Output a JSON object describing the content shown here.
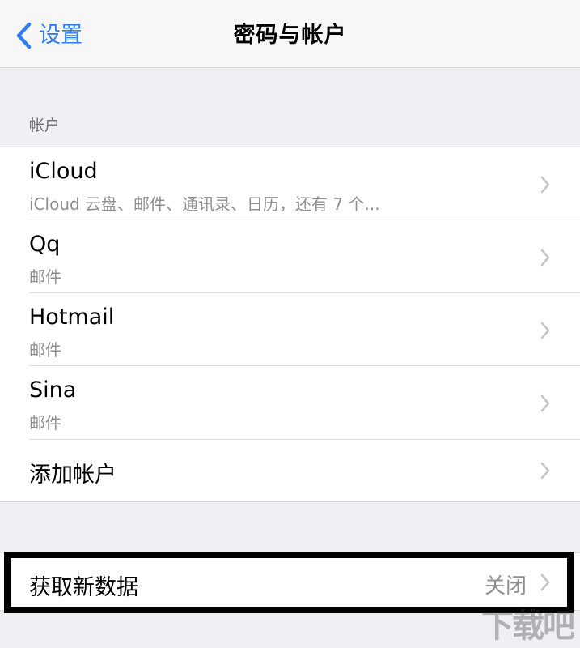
{
  "navbar": {
    "back_label": "设置",
    "title": "密码与帐户"
  },
  "accounts_section": {
    "header": "帐户",
    "items": [
      {
        "title": "iCloud",
        "subtitle": "iCloud 云盘、邮件、通讯录、日历，还有 7 个..."
      },
      {
        "title": "Qq",
        "subtitle": "邮件"
      },
      {
        "title": "Hotmail",
        "subtitle": "邮件"
      },
      {
        "title": "Sina",
        "subtitle": "邮件"
      },
      {
        "title": "添加帐户"
      }
    ]
  },
  "fetch_section": {
    "label": "获取新数据",
    "value": "关闭"
  },
  "colors": {
    "accent": "#2f7cf6",
    "background": "#efeff4",
    "secondary_text": "#8e8e93"
  },
  "icons": {
    "back": "chevron-left-icon",
    "disclosure": "chevron-right-icon"
  }
}
